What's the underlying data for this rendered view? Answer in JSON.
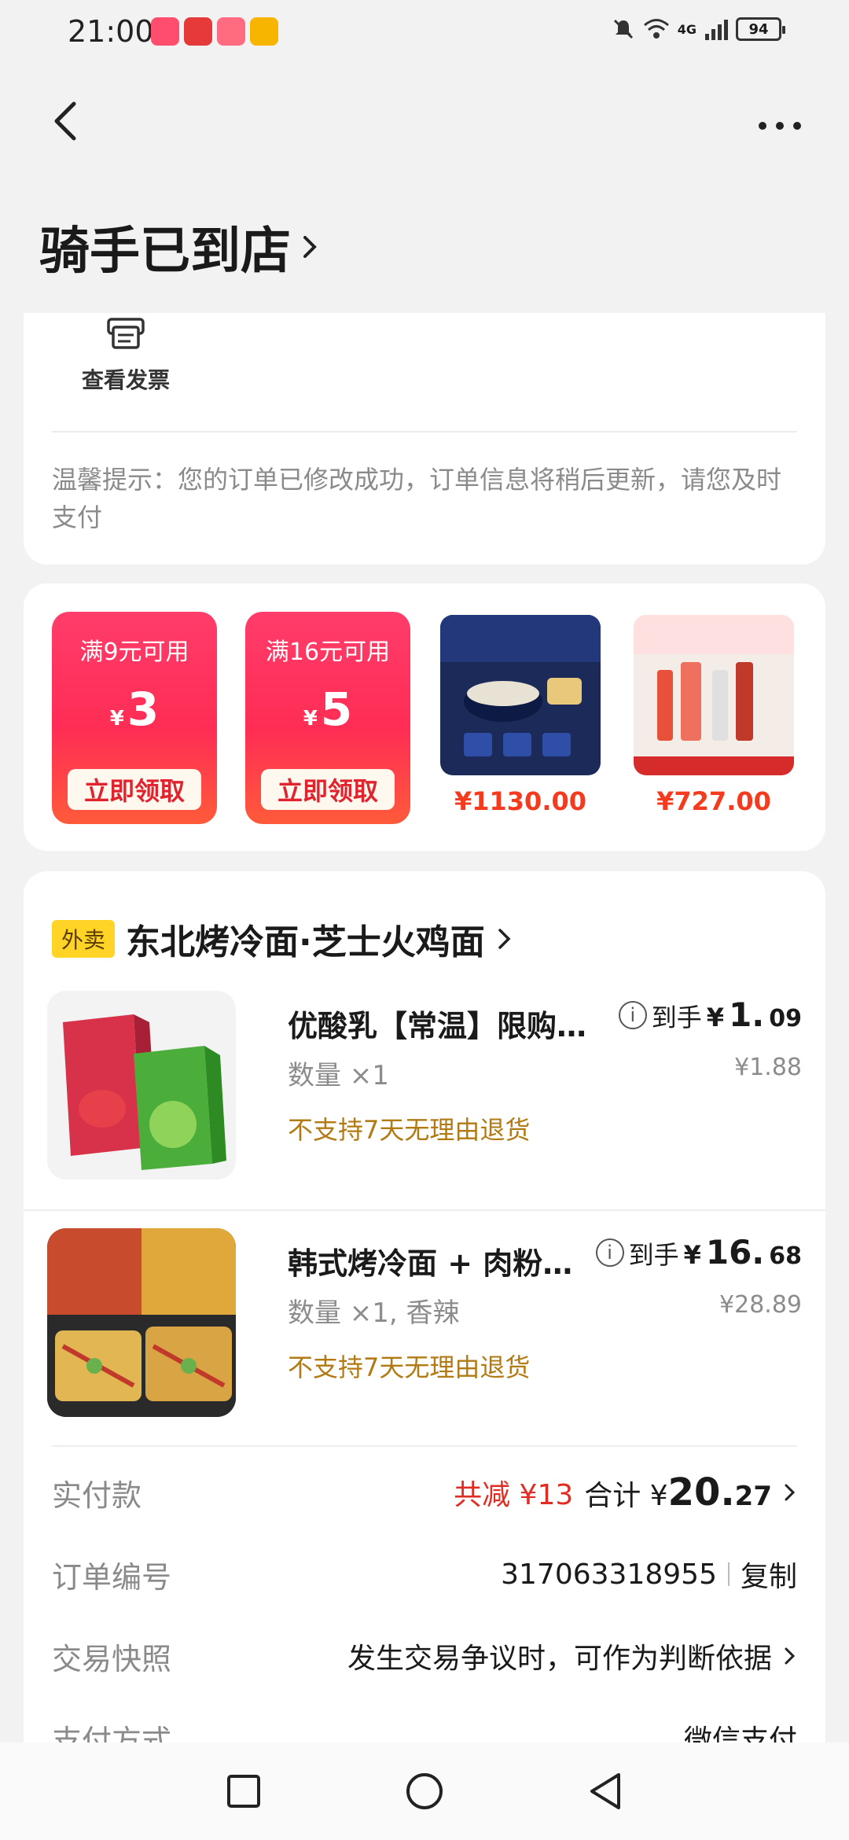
{
  "status_bar": {
    "time": "21:00",
    "apps": [
      "618",
      "HUAWEI",
      "618",
      "weibo"
    ],
    "network": "4G",
    "battery": "94"
  },
  "header": {
    "title": "骑手已到店",
    "back_icon": "chevron-left-icon",
    "more_icon": "more-dots-icon"
  },
  "invoice": {
    "label": "查看发票",
    "icon": "invoice-icon"
  },
  "tip": "温馨提示：您的订单已修改成功，订单信息将稍后更新，请您及时支付",
  "coupons": [
    {
      "condition": "满9元可用",
      "symbol": "¥",
      "amount": "3",
      "button": "立即领取"
    },
    {
      "condition": "满16元可用",
      "symbol": "¥",
      "amount": "5",
      "button": "立即领取"
    }
  ],
  "promo_products": [
    {
      "price": "¥1130.00"
    },
    {
      "price": "¥727.00"
    }
  ],
  "store": {
    "tag": "外卖",
    "name": "东北烤冷面·芝士火鸡面"
  },
  "items": [
    {
      "title": "优酸乳【常温】限购…",
      "price_label": "到手",
      "price_symbol": "¥",
      "price_int": "1.",
      "price_dec": "09",
      "quantity": "数量 ×1",
      "original_price": "¥1.88",
      "note": "不支持7天无理由退货"
    },
    {
      "title": "韩式烤冷面 + 肉粉…",
      "price_label": "到手",
      "price_symbol": "¥",
      "price_int": "16.",
      "price_dec": "68",
      "quantity": "数量 ×1, 香辣",
      "original_price": "¥28.89",
      "note": "不支持7天无理由退货"
    }
  ],
  "payment": {
    "label": "实付款",
    "discount": "共减 ¥13",
    "total_label": "合计 ¥",
    "total_int": "20.",
    "total_dec": "27"
  },
  "order_no": {
    "label": "订单编号",
    "value": "317063318955",
    "copy": "复制"
  },
  "snapshot": {
    "label": "交易快照",
    "value": "发生交易争议时，可作为判断依据"
  },
  "pay_method": {
    "label": "支付方式",
    "value": "微信支付"
  },
  "nav": [
    "recent-apps-icon",
    "home-icon",
    "back-icon"
  ],
  "colors": {
    "accent_red": "#e02d24",
    "coupon_red": "#ff2d55",
    "tag_yellow": "#ffd426",
    "note_brown": "#b27a14"
  }
}
